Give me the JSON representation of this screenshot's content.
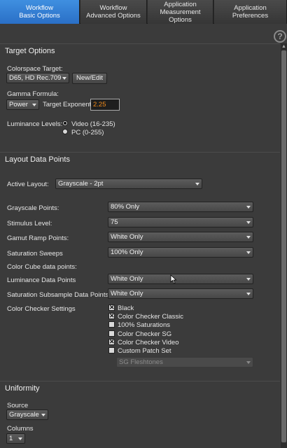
{
  "tabs": [
    {
      "line1": "Workflow",
      "line2": "Basic Options",
      "active": true
    },
    {
      "line1": "Workflow",
      "line2": "Advanced Options",
      "active": false
    },
    {
      "line1": "Application",
      "line2": "Measurement Options",
      "active": false
    },
    {
      "line1": "Application",
      "line2": "Preferences",
      "active": false
    }
  ],
  "help_glyph": "?",
  "target_options": {
    "title": "Target Options",
    "colorspace_label": "Colorspace Target:",
    "colorspace_value": "D65, HD Rec.709",
    "new_edit_label": "New/Edit",
    "gamma_label": "Gamma Formula:",
    "gamma_value": "Power",
    "exponent_label": "Target Exponent",
    "exponent_value": "2.25",
    "luminance_label": "Luminance Levels:",
    "luminance_options": [
      "Video (16-235)",
      "PC (0-255)"
    ],
    "luminance_selected": "Video (16-235)"
  },
  "layout": {
    "title": "Layout Data Points",
    "active_layout_label": "Active Layout:",
    "active_layout_value": "Grayscale - 2pt",
    "grayscale_label": "Grayscale Points:",
    "grayscale_value": "80% Only",
    "stimulus_label": "Stimulus Level:",
    "stimulus_value": "75",
    "gamut_label": "Gamut Ramp Points:",
    "gamut_value": "White Only",
    "saturation_label": "Saturation Sweeps",
    "saturation_value": "100% Only",
    "cube_label": "Color Cube data points:",
    "luminance_dp_label": "Luminance Data Points",
    "luminance_dp_value": "White Only",
    "sat_sub_label": "Saturation Subsample Data Points",
    "sat_sub_value": "White Only",
    "checker_label": "Color Checker Settings",
    "checker_items": [
      {
        "label": "Black",
        "checked": true
      },
      {
        "label": "Color Checker Classic",
        "checked": true
      },
      {
        "label": "100% Saturations",
        "checked": false
      },
      {
        "label": "Color Checker SG",
        "checked": false
      },
      {
        "label": "Color Checker Video",
        "checked": true
      },
      {
        "label": "Custom Patch Set",
        "checked": false
      }
    ],
    "patch_set_value": "SG Fleshtones"
  },
  "uniformity": {
    "title": "Uniformity",
    "source_label": "Source",
    "source_value": "Grayscale",
    "columns_label": "Columns",
    "columns_value": "1"
  },
  "check_glyph": "✕"
}
